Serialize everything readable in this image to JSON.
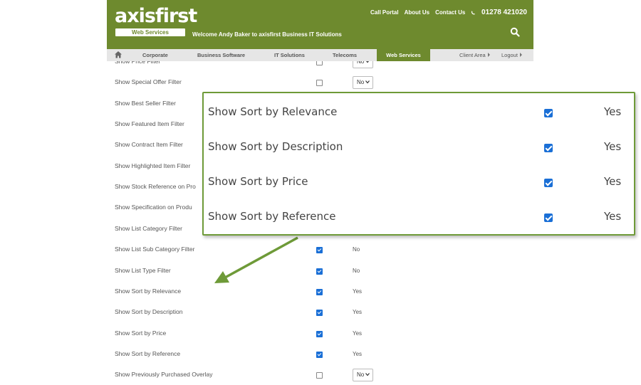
{
  "header": {
    "logo": "axisfirst",
    "logo_tag": "Web Services",
    "welcome": "Welcome Andy Baker to axisfirst Business IT Solutions",
    "links": [
      "Call Portal",
      "About Us",
      "Contact Us"
    ],
    "phone": "01278 421020"
  },
  "nav": {
    "items": [
      "Corporate",
      "Business Software",
      "IT Solutions",
      "Telecoms",
      "Web Services"
    ],
    "active": "Web Services",
    "client_area": "Client Area",
    "logout": "Logout"
  },
  "rows": [
    {
      "label": "Show Price Filter",
      "checked": false,
      "value": "No",
      "control": "select"
    },
    {
      "label": "Show Special Offer Filter",
      "checked": false,
      "value": "No",
      "control": "select"
    },
    {
      "label": "Show Best Seller Filter",
      "checked": false,
      "value": "",
      "control": "none"
    },
    {
      "label": "Show Featured Item Filter",
      "checked": false,
      "value": "",
      "control": "none"
    },
    {
      "label": "Show Contract Item Filter",
      "checked": false,
      "value": "",
      "control": "none"
    },
    {
      "label": "Show Highlighted Item Filter",
      "checked": false,
      "value": "",
      "control": "none"
    },
    {
      "label": "Show Stock Reference on Pro",
      "checked": false,
      "value": "",
      "control": "none"
    },
    {
      "label": "Show Specification on Produ",
      "checked": false,
      "value": "",
      "control": "none"
    },
    {
      "label": "Show List Category Filter",
      "checked": false,
      "value": "",
      "control": "none"
    },
    {
      "label": "Show List Sub Category Filter",
      "checked": true,
      "value": "No",
      "control": "text"
    },
    {
      "label": "Show List Type Filter",
      "checked": true,
      "value": "No",
      "control": "text"
    },
    {
      "label": "Show Sort by Relevance",
      "checked": true,
      "value": "Yes",
      "control": "text"
    },
    {
      "label": "Show Sort by Description",
      "checked": true,
      "value": "Yes",
      "control": "text"
    },
    {
      "label": "Show Sort by Price",
      "checked": true,
      "value": "Yes",
      "control": "text"
    },
    {
      "label": "Show Sort by Reference",
      "checked": true,
      "value": "Yes",
      "control": "text"
    },
    {
      "label": "Show Previously Purchased Overlay",
      "checked": false,
      "value": "No",
      "control": "select"
    }
  ],
  "callout": [
    {
      "label": "Show Sort by Relevance",
      "checked": true,
      "value": "Yes"
    },
    {
      "label": "Show Sort by Description",
      "checked": true,
      "value": "Yes"
    },
    {
      "label": "Show Sort by Price",
      "checked": true,
      "value": "Yes"
    },
    {
      "label": "Show Sort by Reference",
      "checked": true,
      "value": "Yes"
    }
  ],
  "colors": {
    "brand": "#6e8a2e",
    "callout_border": "#6e9a38",
    "checkbox": "#1a6fd6"
  },
  "icons": {
    "home": "home-icon",
    "search": "search-icon",
    "phone": "phone-icon",
    "chevron": "chevron-down-icon",
    "arrow": "callout-arrow"
  }
}
